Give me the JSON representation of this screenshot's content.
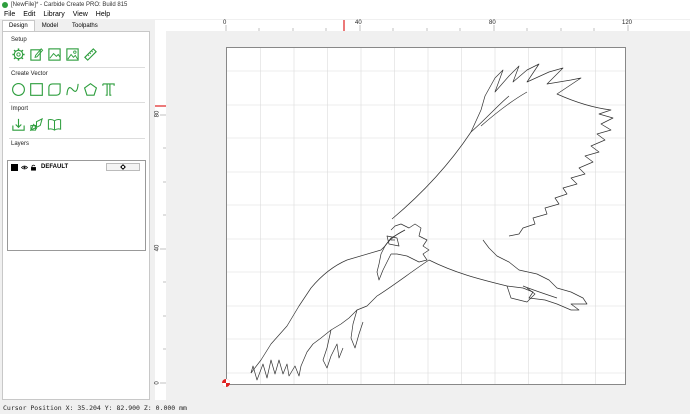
{
  "window": {
    "title": "[NewFile]* - Carbide Create PRO: Build 815"
  },
  "menu": [
    "File",
    "Edit",
    "Library",
    "View",
    "Help"
  ],
  "tabs": [
    {
      "label": "Design",
      "active": true
    },
    {
      "label": "Model",
      "active": false
    },
    {
      "label": "Toolpaths",
      "active": false
    }
  ],
  "sections": {
    "setup": "Setup",
    "create_vector": "Create Vector",
    "import": "Import",
    "layers": "Layers"
  },
  "icons": {
    "setup": [
      "gear-icon",
      "edit-document-icon",
      "image-icon",
      "picture-icon",
      "ruler-icon"
    ],
    "create_vector": [
      "circle-icon",
      "rectangle-icon",
      "ellipse-icon",
      "curve-icon",
      "polygon-icon",
      "text-icon"
    ],
    "import": [
      "import-icon",
      "tracing-icon",
      "library-icon"
    ]
  },
  "layers": [
    {
      "name": "DEFAULT",
      "color": "#000000"
    }
  ],
  "ruler": {
    "top_labels": [
      "0",
      "40",
      "80",
      "120"
    ],
    "left_labels": [
      "80",
      "40",
      "0"
    ]
  },
  "status": {
    "text": "Cursor Position X: 35.204 Y: 82.900 Z: 0.000 mm"
  },
  "colors": {
    "accent": "#2e9e3e",
    "cursor_marker": "#e02020"
  }
}
